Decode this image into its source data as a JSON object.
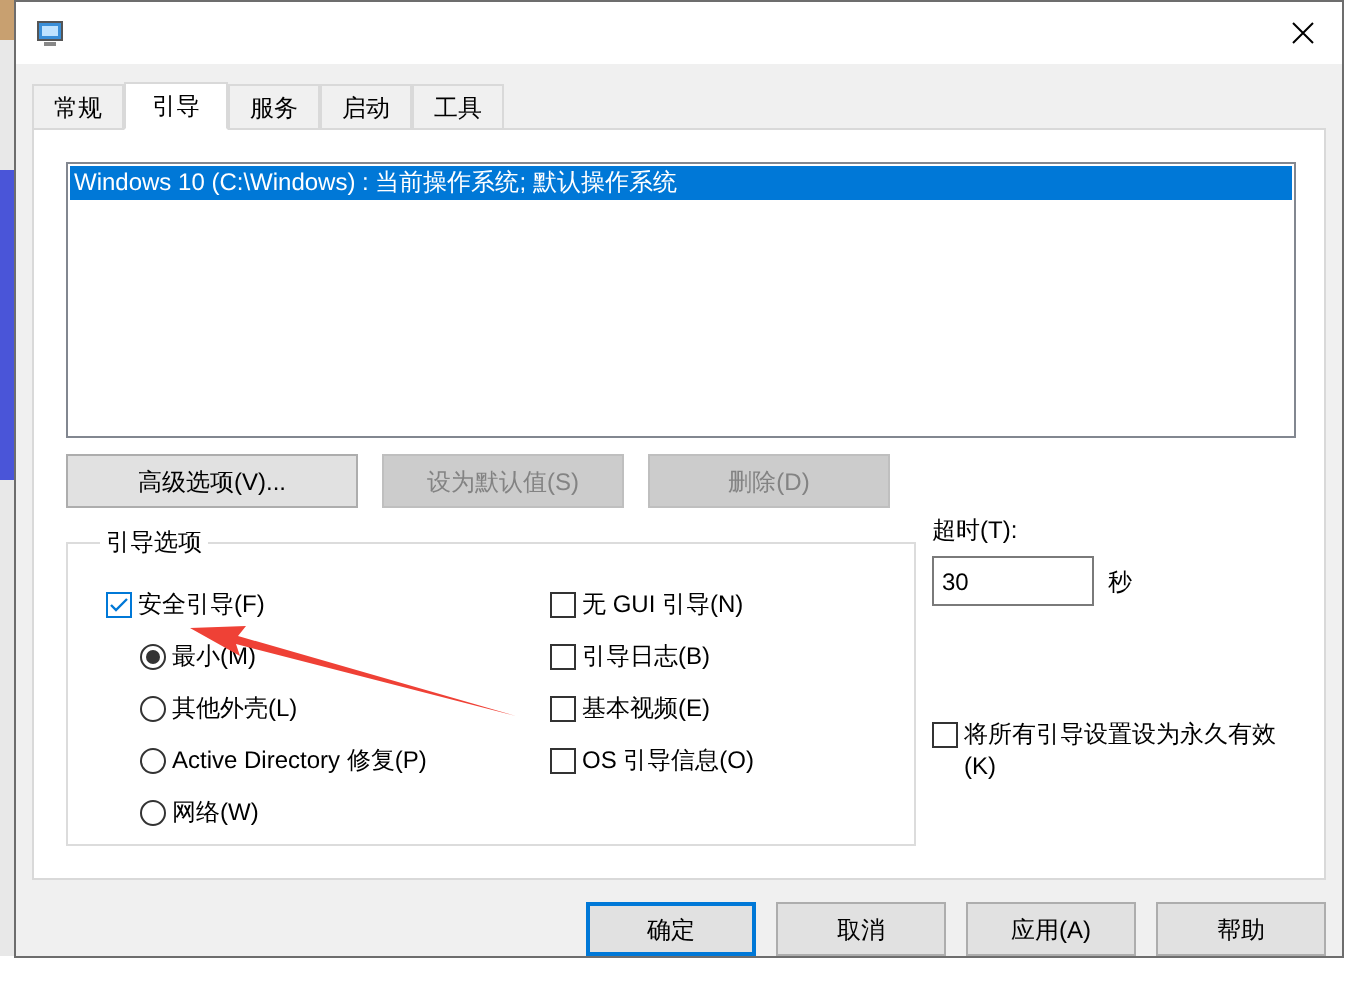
{
  "tabs": [
    {
      "label": "常规",
      "selected": false
    },
    {
      "label": "引导",
      "selected": true
    },
    {
      "label": "服务",
      "selected": false
    },
    {
      "label": "启动",
      "selected": false
    },
    {
      "label": "工具",
      "selected": false
    }
  ],
  "boot_list": [
    {
      "label": "Windows 10 (C:\\Windows) : 当前操作系统; 默认操作系统",
      "selected": true
    }
  ],
  "list_buttons": [
    {
      "label": "高级选项(V)...",
      "disabled": false
    },
    {
      "label": "设为默认值(S)",
      "disabled": true
    },
    {
      "label": "删除(D)",
      "disabled": true
    }
  ],
  "boot_options": {
    "title": "引导选项",
    "safe_boot": {
      "label": "安全引导(F)",
      "checked": true
    },
    "safe_boot_modes": [
      {
        "label": "最小(M)",
        "selected": true
      },
      {
        "label": "其他外壳(L)",
        "selected": false
      },
      {
        "label": "Active Directory 修复(P)",
        "selected": false
      },
      {
        "label": "网络(W)",
        "selected": false
      }
    ],
    "extra_options": [
      {
        "label": "无 GUI 引导(N)",
        "checked": false
      },
      {
        "label": "引导日志(B)",
        "checked": false
      },
      {
        "label": "基本视频(E)",
        "checked": false
      },
      {
        "label": "OS 引导信息(O)",
        "checked": false
      }
    ]
  },
  "timeout": {
    "label": "超时(T):",
    "value": "30",
    "unit": "秒"
  },
  "make_permanent": {
    "label": "将所有引导设置设为永久有效 (K)",
    "checked": false
  },
  "buttons": [
    {
      "label": "确定",
      "focused": true
    },
    {
      "label": "取消",
      "focused": false
    },
    {
      "label": "应用(A)",
      "focused": false
    },
    {
      "label": "帮助",
      "focused": false
    }
  ]
}
